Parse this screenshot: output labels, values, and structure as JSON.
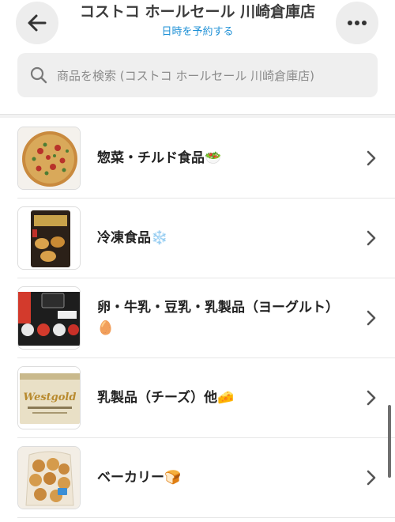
{
  "header": {
    "store_title": "コストコ ホールセール 川崎倉庫店",
    "schedule_link": "日時を予約する",
    "back_icon": "arrow-left-icon",
    "more_icon": "more-horizontal-icon"
  },
  "search": {
    "placeholder": "商品を検索 (コストコ ホールセール 川崎倉庫店)",
    "icon": "search-icon"
  },
  "categories": [
    {
      "label": "惣菜・チルド食品🥗",
      "thumb": "pizza"
    },
    {
      "label": "冷凍食品❄️",
      "thumb": "frozen-dumplings"
    },
    {
      "label": "卵・牛乳・豆乳・乳製品（ヨーグルト）🥚",
      "thumb": "yogurt-pack"
    },
    {
      "label": "乳製品（チーズ）他🧀",
      "thumb": "westgold-butter",
      "thumb_text": "Westgold"
    },
    {
      "label": "ベーカリー🍞",
      "thumb": "bread-rolls"
    }
  ],
  "colors": {
    "accent": "#1e90d6",
    "button_bg": "#ededed",
    "search_bg": "#efefef",
    "divider": "#e6e6e6"
  }
}
